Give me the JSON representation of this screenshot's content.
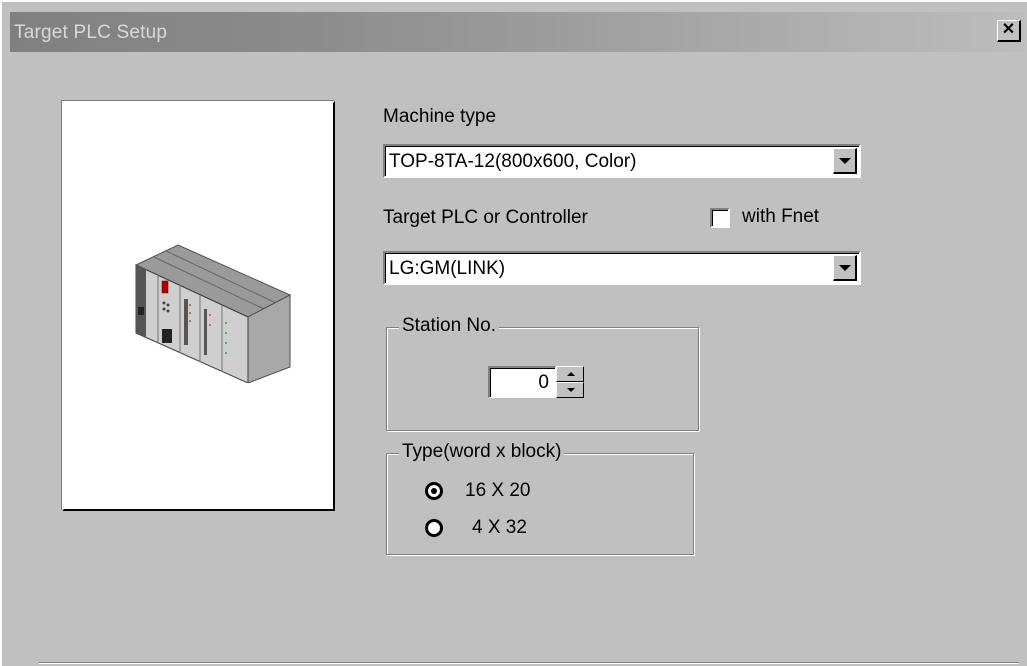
{
  "window": {
    "title": "Target PLC Setup",
    "close_symbol": "✕"
  },
  "preview": {
    "image_icon": "plc-rack-icon"
  },
  "machine_type": {
    "label": "Machine type",
    "value": "TOP-8TA-12(800x600, Color)"
  },
  "target_plc": {
    "label": "Target PLC or Controller",
    "value": "LG:GM(LINK)"
  },
  "fnet": {
    "label": "with Fnet",
    "checked": false
  },
  "station": {
    "legend": "Station No.",
    "value": "0"
  },
  "type_group": {
    "legend": "Type(word x block)",
    "options": [
      {
        "label": "16 X 20",
        "selected": true
      },
      {
        "label": "4 X 32",
        "selected": false
      }
    ]
  },
  "colors": {
    "dialog_bg": "#c0c0c0",
    "title_gradient_start": "#808080",
    "title_text": "#d8d8d8"
  }
}
